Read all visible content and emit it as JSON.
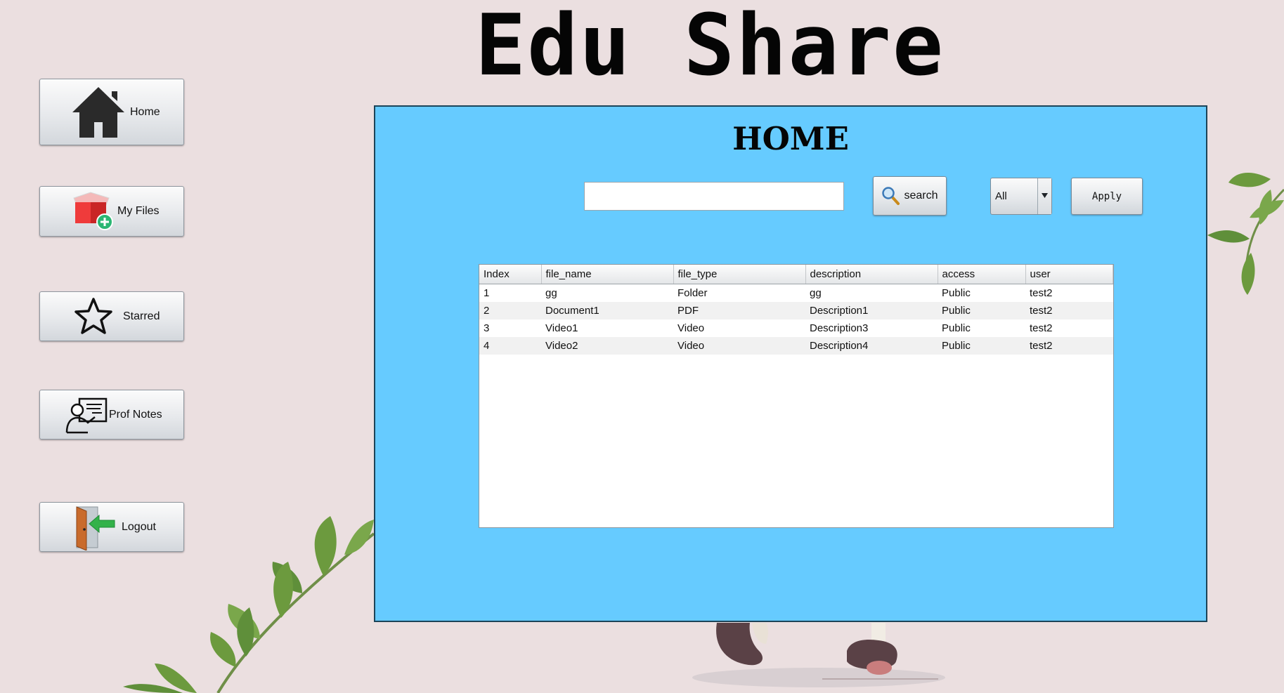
{
  "app": {
    "title": "Edu Share"
  },
  "sidebar": {
    "items": [
      {
        "label": "Home",
        "icon": "home-icon"
      },
      {
        "label": "My Files",
        "icon": "add-box-icon"
      },
      {
        "label": "Starred",
        "icon": "star-icon"
      },
      {
        "label": "Prof Notes",
        "icon": "professor-board-icon"
      },
      {
        "label": "Logout",
        "icon": "exit-door-icon"
      }
    ]
  },
  "main": {
    "title": "HOME",
    "search": {
      "value": "",
      "placeholder": "",
      "button_label": "search",
      "button_icon": "magnifier-icon"
    },
    "filter": {
      "selected": "All"
    },
    "apply_label": "Apply",
    "table": {
      "columns": [
        "Index",
        "file_name",
        "file_type",
        "description",
        "access",
        "user"
      ],
      "rows": [
        [
          "1",
          "gg",
          "Folder",
          "gg",
          "Public",
          "test2"
        ],
        [
          "2",
          "Document1",
          "PDF",
          "Description1",
          "Public",
          "test2"
        ],
        [
          "3",
          "Video1",
          "Video",
          "Description3",
          "Public",
          "test2"
        ],
        [
          "4",
          "Video2",
          "Video",
          "Description4",
          "Public",
          "test2"
        ]
      ]
    }
  },
  "colors": {
    "background": "#ebdfe0",
    "panel": "#66cbff",
    "panel_border": "#1c4458",
    "leaf": "#5f8f3a"
  }
}
